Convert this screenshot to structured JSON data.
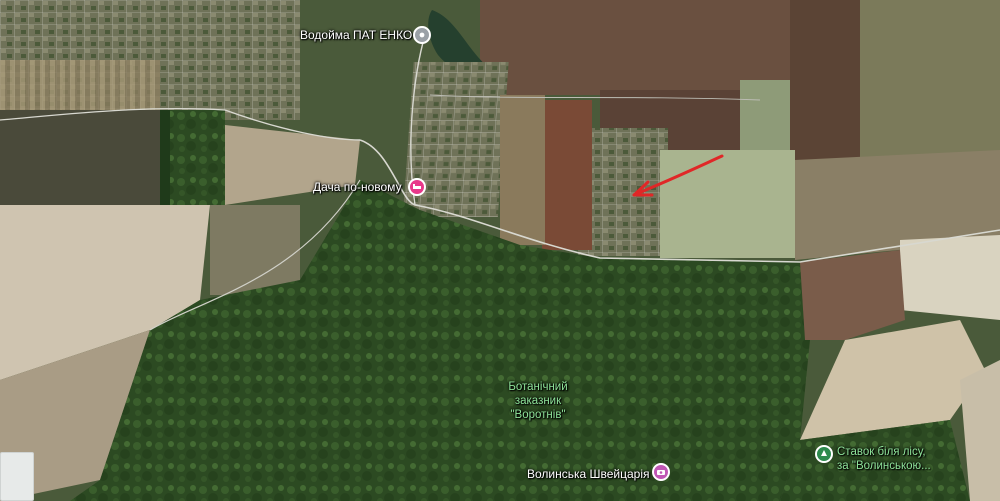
{
  "places": {
    "reservoir": {
      "label": "Водойма ПАТ ЕНКО",
      "icon": "map-marker-icon",
      "color": "#9aa0a6"
    },
    "dacha": {
      "label": "Дача по-новому",
      "icon": "lodging-icon",
      "color": "#e8388a"
    },
    "reserve": {
      "line1": "Ботанічний",
      "line2": "заказник",
      "line3": "\"Воротнів\""
    },
    "switzerland": {
      "label": "Волинська Швейцарія",
      "icon": "camera-icon",
      "color": "#c057b5"
    },
    "pond": {
      "line1": "Ставок біля лісу,",
      "line2": "за \"Волинською...",
      "icon": "nature-pin-icon",
      "color": "#2e8a4e"
    }
  },
  "annotation": {
    "icon": "red-arrow-annotation",
    "color": "#e02727"
  },
  "map_type": "satellite"
}
